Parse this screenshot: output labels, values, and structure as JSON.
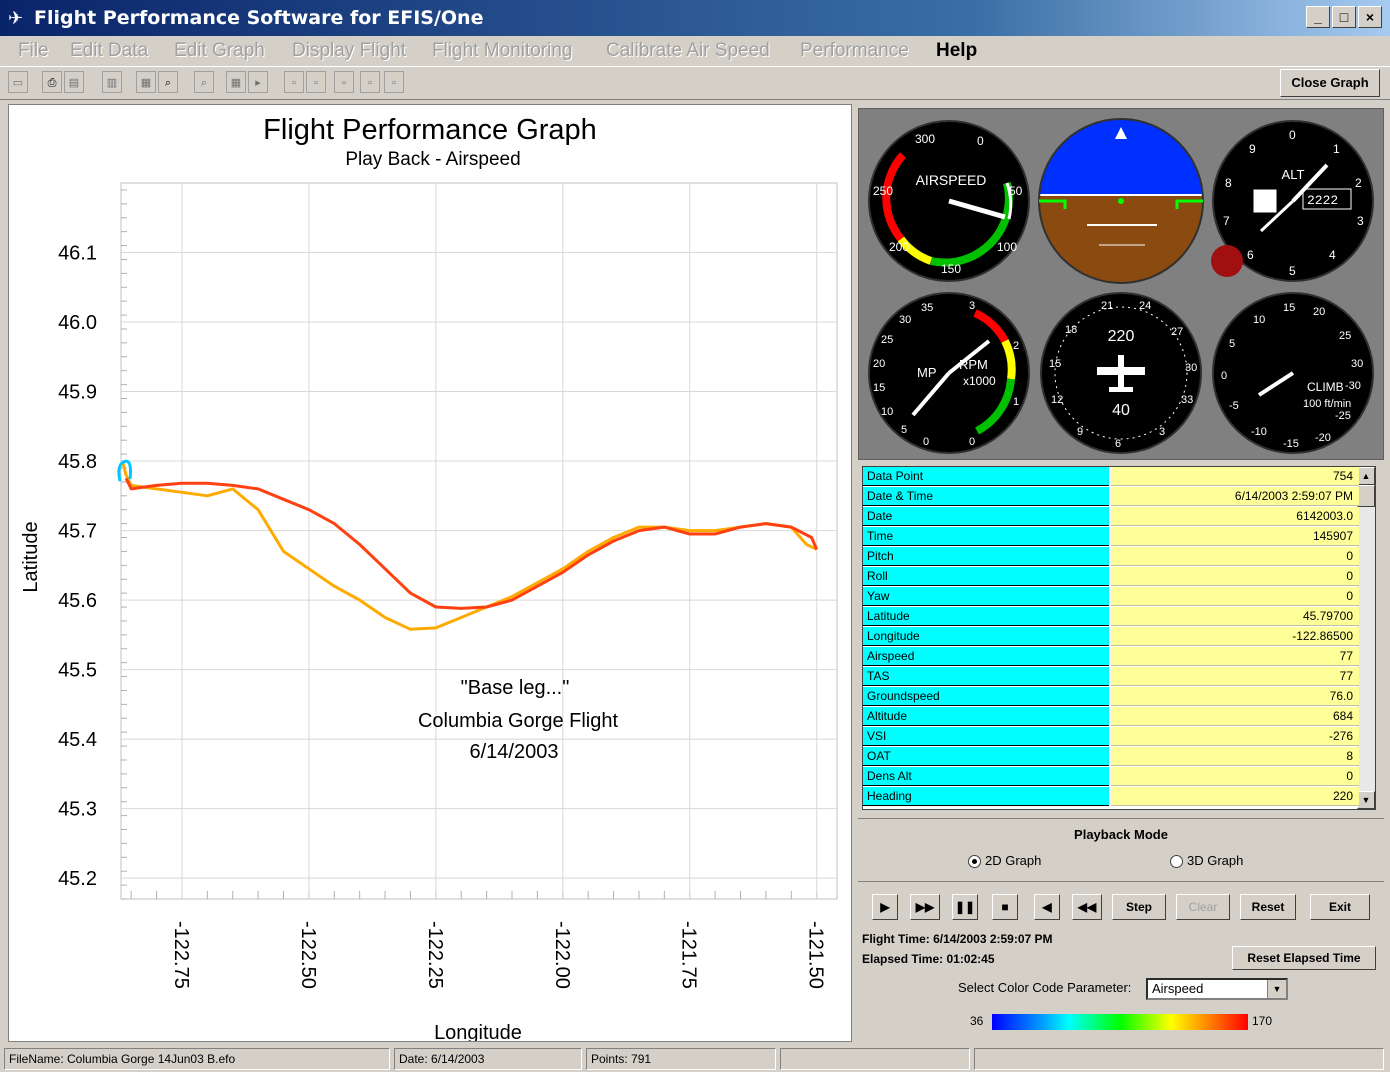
{
  "window": {
    "title": "Flight Performance Software for EFIS/One",
    "minimize": "_",
    "maximize": "□",
    "close": "×"
  },
  "menu": [
    "File",
    "Edit Data",
    "Edit Graph",
    "Display Flight",
    "Flight Monitoring",
    "Calibrate Air Speed",
    "Performance",
    "Help"
  ],
  "toolbar": {
    "close_graph": "Close Graph"
  },
  "graph": {
    "title": "Flight Performance Graph",
    "subtitle": "Play Back -  Airspeed",
    "annotation": [
      "\"Base leg...\"",
      "Columbia Gorge Flight",
      "6/14/2003"
    ]
  },
  "chart_data": {
    "type": "line",
    "xlabel": "Longitude",
    "ylabel": "Latitude",
    "xlim": [
      -122.87,
      -121.46
    ],
    "ylim": [
      45.17,
      46.2
    ],
    "xticks": [
      -122.75,
      -122.5,
      -122.25,
      -122.0,
      -121.75,
      -121.5
    ],
    "xtick_labels": [
      "-122.75",
      "-122.50",
      "-122.25",
      "-122.00",
      "-121.75",
      "-121.50"
    ],
    "yticks": [
      45.2,
      45.3,
      45.4,
      45.5,
      45.6,
      45.7,
      45.8,
      45.9,
      46.0,
      46.1
    ],
    "ytick_labels": [
      "45.2",
      "45.3",
      "45.4",
      "45.5",
      "45.6",
      "45.7",
      "45.8",
      "45.9",
      "46.0",
      "46.1"
    ],
    "grid": true,
    "color_parameter": "Airspeed",
    "series": [
      {
        "color": "#ffaa00",
        "points": [
          [
            -122.866,
            45.797
          ],
          [
            -122.86,
            45.78
          ],
          [
            -122.85,
            45.765
          ],
          [
            -122.8,
            45.76
          ],
          [
            -122.75,
            45.755
          ],
          [
            -122.7,
            45.75
          ],
          [
            -122.65,
            45.76
          ],
          [
            -122.6,
            45.73
          ],
          [
            -122.55,
            45.67
          ],
          [
            -122.5,
            45.645
          ],
          [
            -122.45,
            45.62
          ],
          [
            -122.4,
            45.6
          ],
          [
            -122.35,
            45.575
          ],
          [
            -122.3,
            45.558
          ],
          [
            -122.25,
            45.56
          ],
          [
            -122.2,
            45.575
          ],
          [
            -122.15,
            45.59
          ],
          [
            -122.1,
            45.605
          ],
          [
            -122.05,
            45.625
          ],
          [
            -122.0,
            45.645
          ],
          [
            -121.95,
            45.67
          ],
          [
            -121.9,
            45.69
          ],
          [
            -121.85,
            45.705
          ],
          [
            -121.8,
            45.705
          ],
          [
            -121.75,
            45.7
          ],
          [
            -121.7,
            45.7
          ],
          [
            -121.65,
            45.705
          ],
          [
            -121.6,
            45.71
          ],
          [
            -121.55,
            45.705
          ],
          [
            -121.52,
            45.68
          ],
          [
            -121.5,
            45.673
          ]
        ]
      },
      {
        "color": "#ff4010",
        "points": [
          [
            -121.5,
            45.673
          ],
          [
            -121.51,
            45.69
          ],
          [
            -121.55,
            45.705
          ],
          [
            -121.6,
            45.71
          ],
          [
            -121.65,
            45.705
          ],
          [
            -121.7,
            45.695
          ],
          [
            -121.75,
            45.695
          ],
          [
            -121.8,
            45.705
          ],
          [
            -121.85,
            45.7
          ],
          [
            -121.9,
            45.685
          ],
          [
            -121.95,
            45.665
          ],
          [
            -122.0,
            45.64
          ],
          [
            -122.05,
            45.62
          ],
          [
            -122.1,
            45.6
          ],
          [
            -122.15,
            45.59
          ],
          [
            -122.2,
            45.588
          ],
          [
            -122.25,
            45.59
          ],
          [
            -122.3,
            45.61
          ],
          [
            -122.35,
            45.645
          ],
          [
            -122.4,
            45.68
          ],
          [
            -122.45,
            45.71
          ],
          [
            -122.5,
            45.73
          ],
          [
            -122.55,
            45.745
          ],
          [
            -122.6,
            45.76
          ],
          [
            -122.65,
            45.765
          ],
          [
            -122.7,
            45.768
          ],
          [
            -122.75,
            45.768
          ],
          [
            -122.8,
            45.765
          ],
          [
            -122.85,
            45.76
          ],
          [
            -122.86,
            45.775
          ]
        ]
      }
    ]
  },
  "gauges": {
    "airspeed": {
      "label": "AIRSPEED",
      "ticks": [
        "300",
        "0",
        "250",
        "50",
        "200",
        "100",
        "150"
      ]
    },
    "altimeter": {
      "label": "ALT",
      "ticks": [
        "0",
        "1",
        "2",
        "3",
        "4",
        "5",
        "6",
        "7",
        "8",
        "9"
      ],
      "window": "2222"
    },
    "rpm": {
      "label": "RPM",
      "sublabel": "x1000",
      "mp_label": "MP",
      "ticks_mp": [
        "35",
        "30",
        "25",
        "20",
        "15",
        "10",
        "5",
        "0"
      ],
      "ticks_rpm": [
        "3",
        "2",
        "1",
        "0"
      ]
    },
    "heading": {
      "top": "220",
      "bottom": "40",
      "ticks": [
        "21",
        "24",
        "27",
        "30",
        "33",
        "3",
        "6",
        "9",
        "12",
        "15",
        "18"
      ]
    },
    "climb": {
      "label": "CLIMB",
      "sublabel": "100 ft/min",
      "ticks": [
        "15",
        "20",
        "25",
        "30",
        "-30",
        "-25",
        "-20",
        "-15",
        "-10",
        "-5",
        "0",
        "5",
        "10"
      ]
    }
  },
  "data_table": [
    {
      "label": "Data Point",
      "value": "754"
    },
    {
      "label": "Date & Time",
      "value": "6/14/2003 2:59:07 PM"
    },
    {
      "label": "Date",
      "value": "6142003.0"
    },
    {
      "label": "Time",
      "value": "145907"
    },
    {
      "label": "Pitch",
      "value": "0"
    },
    {
      "label": "Roll",
      "value": "0"
    },
    {
      "label": "Yaw",
      "value": "0"
    },
    {
      "label": "Latitude",
      "value": "45.79700"
    },
    {
      "label": "Longitude",
      "value": "-122.86500"
    },
    {
      "label": "Airspeed",
      "value": "77"
    },
    {
      "label": "TAS",
      "value": "77"
    },
    {
      "label": "Groundspeed",
      "value": "76.0"
    },
    {
      "label": "Altitude",
      "value": "684"
    },
    {
      "label": "VSI",
      "value": "-276"
    },
    {
      "label": "OAT",
      "value": "8"
    },
    {
      "label": "Dens Alt",
      "value": "0"
    },
    {
      "label": "Heading",
      "value": "220"
    }
  ],
  "playback": {
    "title": "Playback Mode",
    "option_2d": "2D Graph",
    "option_3d": "3D Graph",
    "selected": "2D Graph"
  },
  "controls": {
    "play": "▶",
    "fast": "▶▶",
    "pause": "❚❚",
    "stop": "■",
    "back": "◀",
    "rewind": "◀◀",
    "step": "Step",
    "clear": "Clear",
    "reset": "Reset",
    "exit": "Exit",
    "flight_time": "Flight Time: 6/14/2003 2:59:07 PM",
    "elapsed_time": "Elapsed Time: 01:02:45",
    "reset_elapsed": "Reset Elapsed Time",
    "color_param_label": "Select Color Code Parameter:",
    "color_param_value": "Airspeed",
    "scale_min": "36",
    "scale_max": "170"
  },
  "status": {
    "filename": "FileName: Columbia Gorge 14Jun03 B.efo",
    "date": "Date: 6/14/2003",
    "points": "Points: 791"
  }
}
